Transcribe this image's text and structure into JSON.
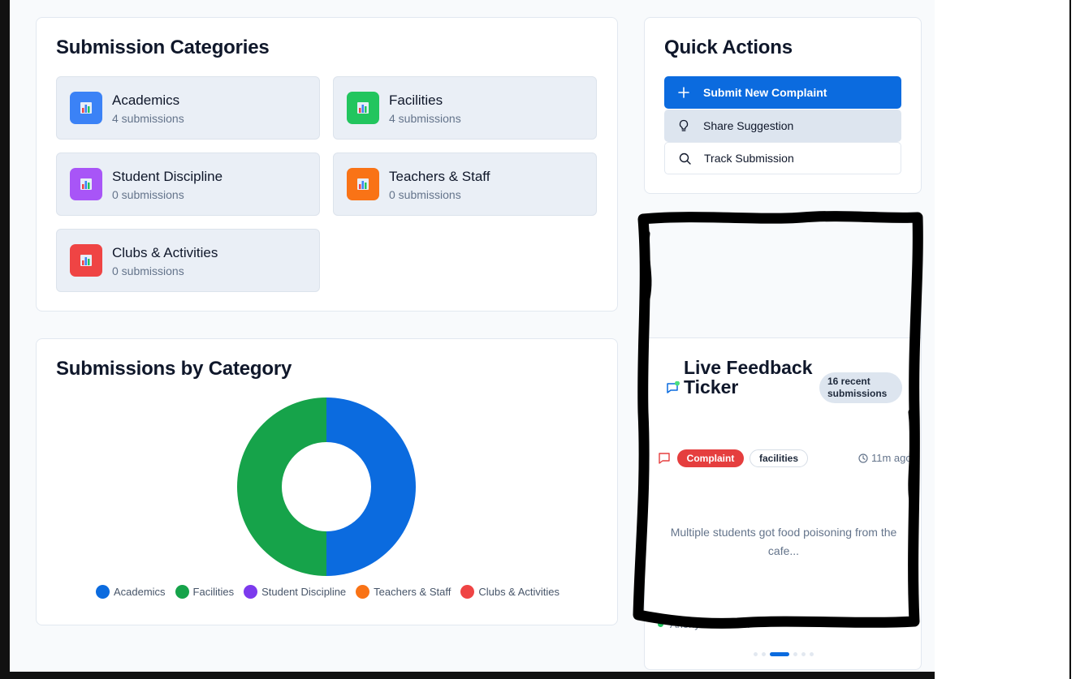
{
  "categories_card": {
    "title": "Submission Categories",
    "items": [
      {
        "name": "Academics",
        "count": "4 submissions",
        "color": "#3b82f6"
      },
      {
        "name": "Facilities",
        "count": "4 submissions",
        "color": "#22c55e"
      },
      {
        "name": "Student Discipline",
        "count": "0 submissions",
        "color": "#a855f7"
      },
      {
        "name": "Teachers & Staff",
        "count": "0 submissions",
        "color": "#f97316"
      },
      {
        "name": "Clubs & Activities",
        "count": "0 submissions",
        "color": "#ef4444"
      }
    ]
  },
  "chart_card": {
    "title": "Submissions by Category"
  },
  "chart_data": {
    "type": "pie",
    "categories": [
      "Academics",
      "Facilities",
      "Student Discipline",
      "Teachers & Staff",
      "Clubs & Activities"
    ],
    "values": [
      4,
      4,
      0,
      0,
      0
    ],
    "colors": [
      "#0b6bdf",
      "#16a34a",
      "#7c3aed",
      "#f97316",
      "#ef4444"
    ],
    "donut": true,
    "legend": "bottom"
  },
  "quick_actions": {
    "title": "Quick Actions",
    "submit_label": "Submit New Complaint",
    "suggest_label": "Share Suggestion",
    "track_label": "Track Submission"
  },
  "ticker": {
    "title": "Live Feedback Ticker",
    "badge": "16 recent submissions",
    "type_label": "Complaint",
    "category_label": "facilities",
    "time": "11m ago",
    "message": "Multiple students got food poisoning from the cafe...",
    "author": "Anonymous User",
    "active_slide": 3,
    "slide_count": 6
  }
}
